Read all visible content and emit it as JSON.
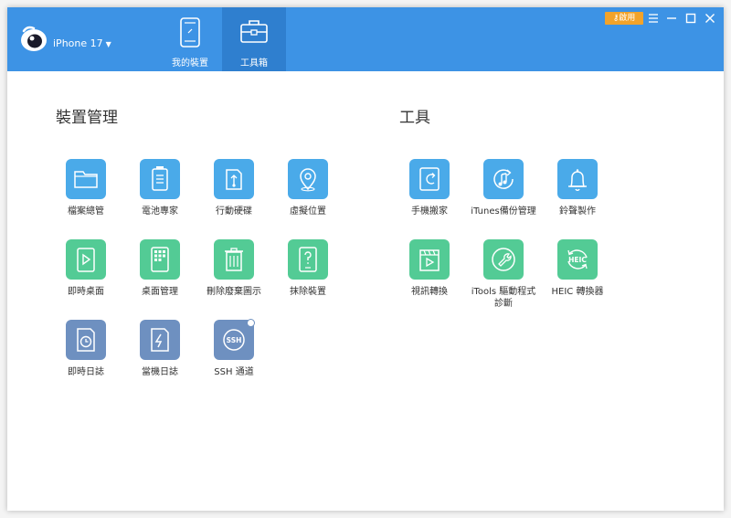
{
  "header": {
    "device_name": "iPhone 17",
    "activate_label": "啟用",
    "tabs": [
      {
        "label": "我的裝置",
        "icon": "phone-icon"
      },
      {
        "label": "工具箱",
        "icon": "toolbox-icon"
      }
    ],
    "active_tab": 1
  },
  "device_section": {
    "title": "裝置管理",
    "items": [
      {
        "label": "檔案總管",
        "icon": "folder-icon",
        "color": "#4aaae9"
      },
      {
        "label": "電池專家",
        "icon": "battery-icon",
        "color": "#4aaae9"
      },
      {
        "label": "行動硬碟",
        "icon": "usb-drive-icon",
        "color": "#4aaae9"
      },
      {
        "label": "虛擬位置",
        "icon": "location-pin-icon",
        "color": "#4aaae9"
      },
      {
        "label": "即時桌面",
        "icon": "play-screen-icon",
        "color": "#53cb95"
      },
      {
        "label": "桌面管理",
        "icon": "app-grid-icon",
        "color": "#53cb95"
      },
      {
        "label": "刪除廢棄圖示",
        "icon": "trash-icon",
        "color": "#53cb95"
      },
      {
        "label": "抹除裝置",
        "icon": "erase-device-icon",
        "color": "#53cb95"
      },
      {
        "label": "即時日誌",
        "icon": "realtime-log-icon",
        "color": "#6e90c0"
      },
      {
        "label": "當機日誌",
        "icon": "crash-log-icon",
        "color": "#6e90c0"
      },
      {
        "label": "SSH 通道",
        "icon": "ssh-icon",
        "badge_text": "SSH",
        "color": "#6e90c0"
      }
    ]
  },
  "tools_section": {
    "title": "工具",
    "items": [
      {
        "label": "手機搬家",
        "icon": "phone-transfer-icon",
        "color": "#4aaae9"
      },
      {
        "label": "iTunes備份管理",
        "icon": "itunes-backup-icon",
        "color": "#4aaae9"
      },
      {
        "label": "鈴聲製作",
        "icon": "bell-icon",
        "color": "#4aaae9"
      },
      {
        "label": "視訊轉換",
        "icon": "video-convert-icon",
        "color": "#53cb95"
      },
      {
        "label": "iTools 驅動程式診斷",
        "icon": "wrench-icon",
        "color": "#53cb95"
      },
      {
        "label": "HEIC 轉換器",
        "icon": "heic-icon",
        "badge_text": "HEIC",
        "color": "#53cb95"
      }
    ]
  }
}
